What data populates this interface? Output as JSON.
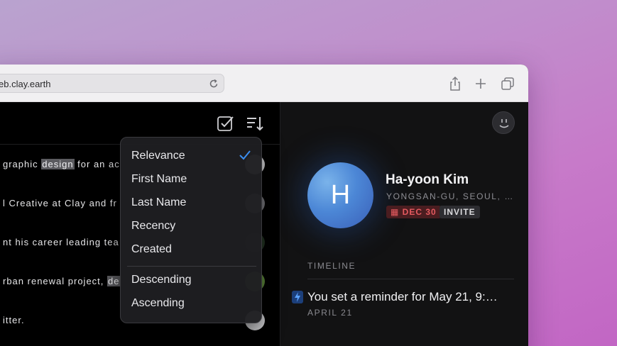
{
  "browser": {
    "url": "eb.clay.earth"
  },
  "list": {
    "rows": [
      {
        "before": "graphic ",
        "highlight": "design",
        "after": " for an ac"
      },
      {
        "before": "l Creative at Clay and fr",
        "highlight": "",
        "after": ""
      },
      {
        "before": "nt his career leading tea",
        "highlight": "",
        "after": ""
      },
      {
        "before": "rban renewal project, ",
        "highlight": "de",
        "after": ""
      },
      {
        "before": "itter.",
        "highlight": "",
        "after": ""
      }
    ]
  },
  "sort_menu": {
    "items": [
      "Relevance",
      "First Name",
      "Last Name",
      "Recency",
      "Created"
    ],
    "selected": "Relevance",
    "order_items": [
      "Descending",
      "Ascending"
    ]
  },
  "contact": {
    "initial": "H",
    "name": "Ha-yoon Kim",
    "location": "YONGSAN-GU, SEOUL, …",
    "date_badge": "DEC 30",
    "invite_badge": "INVITE",
    "timeline_title": "TIMELINE",
    "timeline_entry": "You set a reminder for May 21, 9:…",
    "timeline_date": "APRIL 21"
  },
  "colors": {
    "accent": "#3b8ef0",
    "date_badge_text": "#e55a5f",
    "avatar": "#4c87d6"
  }
}
